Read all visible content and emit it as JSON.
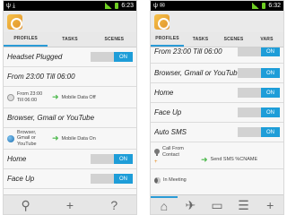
{
  "left": {
    "status_time": "6:23",
    "tabs": [
      "PROFILES",
      "TASKS",
      "SCENES"
    ],
    "rows": {
      "headset": "Headset Plugged",
      "from": "From 23:00 Till 06:00",
      "from_cond": "From 23:00 Till 06:00",
      "from_action": "Mobile Data Off",
      "browser": "Browser, Gmail or YouTube",
      "browser_cond": "Browser, Gmail or YouTube",
      "browser_action": "Mobile Data On",
      "home": "Home",
      "face": "Face Up"
    },
    "toggle_on": "ON",
    "bottom": [
      "⚲",
      "+",
      "?"
    ]
  },
  "right": {
    "status_time": "6:32",
    "tabs": [
      "PROFILES",
      "TASKS",
      "SCENES",
      "VARS"
    ],
    "rows": {
      "from": "From 23:00 Till 06:00",
      "browser": "Browser, Gmail or YouTube",
      "home": "Home",
      "face": "Face Up",
      "autosms": "Auto SMS",
      "call_cond": "Call From Contact",
      "sms_action": "Send SMS %CNAME",
      "meeting": "In Meeting"
    },
    "toggle_on": "ON",
    "bottom": [
      "⌂",
      "✈",
      "▭",
      "☰",
      "+"
    ]
  }
}
